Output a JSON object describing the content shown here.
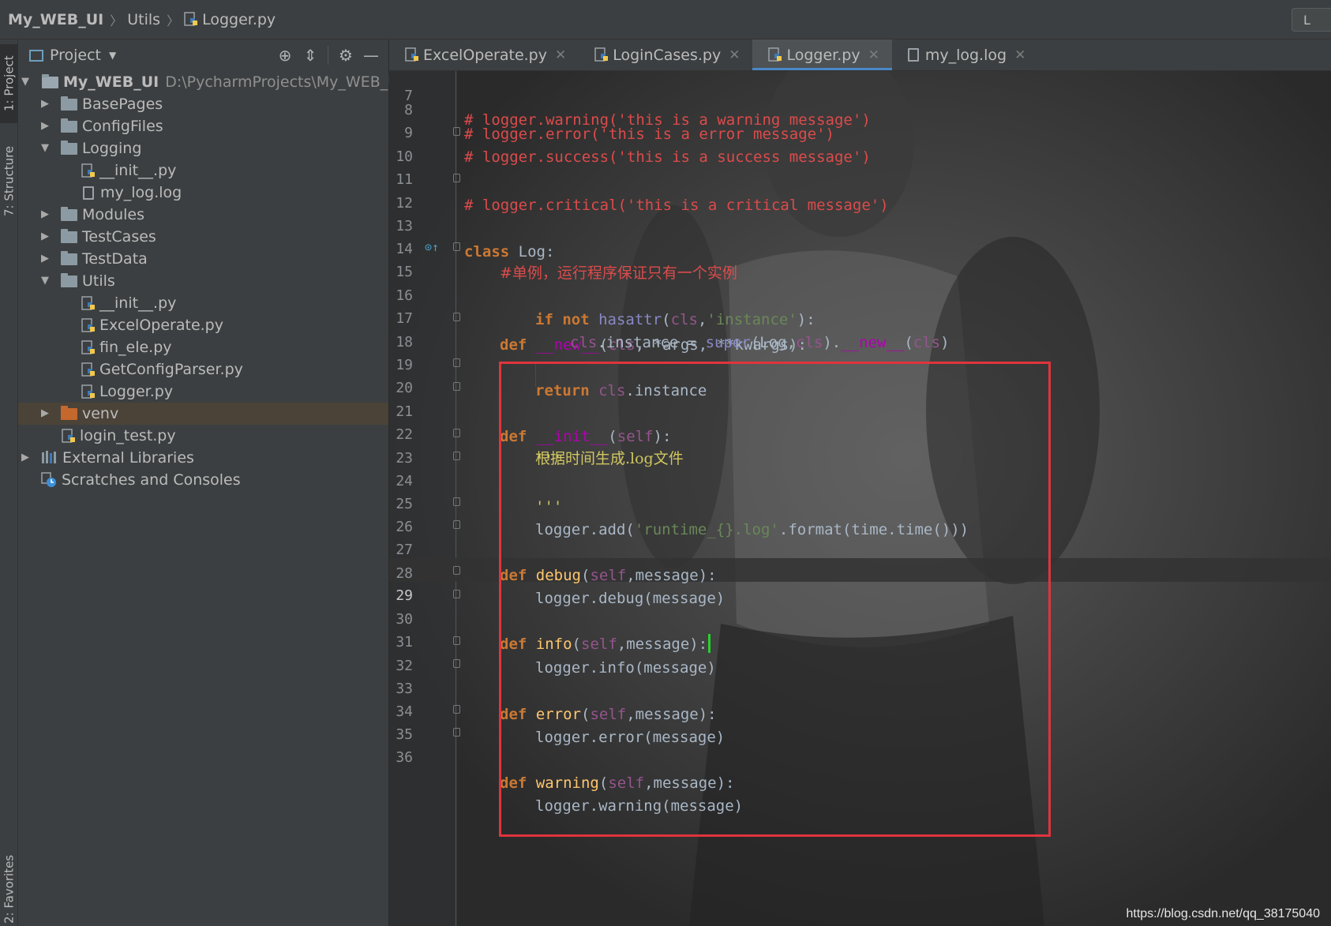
{
  "breadcrumb": {
    "project": "My_WEB_UI",
    "folder": "Utils",
    "file": "Logger.py"
  },
  "navbar_right_label": "L",
  "left_stripe": {
    "project_tab": "1: Project",
    "structure_tab": "7: Structure",
    "favorites_tab": "2: Favorites"
  },
  "project_panel": {
    "title": "Project",
    "tools": [
      "locate-icon",
      "collapse-icon",
      "gear-icon",
      "hide-icon"
    ],
    "tree": [
      {
        "label": "My_WEB_UI",
        "path": "D:\\PycharmProjects\\My_WEB_UI",
        "type": "root",
        "expanded": true
      },
      {
        "label": "BasePages",
        "type": "folder",
        "expanded": false
      },
      {
        "label": "ConfigFiles",
        "type": "folder",
        "expanded": false
      },
      {
        "label": "Logging",
        "type": "folder",
        "expanded": true
      },
      {
        "label": "__init__.py",
        "type": "py"
      },
      {
        "label": "my_log.log",
        "type": "log"
      },
      {
        "label": "Modules",
        "type": "folder",
        "expanded": false
      },
      {
        "label": "TestCases",
        "type": "folder",
        "expanded": false
      },
      {
        "label": "TestData",
        "type": "folder",
        "expanded": false
      },
      {
        "label": "Utils",
        "type": "folder",
        "expanded": true
      },
      {
        "label": "__init__.py",
        "type": "py"
      },
      {
        "label": "ExcelOperate.py",
        "type": "py"
      },
      {
        "label": "fin_ele.py",
        "type": "py"
      },
      {
        "label": "GetConfigParser.py",
        "type": "py"
      },
      {
        "label": "Logger.py",
        "type": "py"
      },
      {
        "label": "venv",
        "type": "folder-orange",
        "expanded": false,
        "selected": true
      },
      {
        "label": "login_test.py",
        "type": "py"
      },
      {
        "label": "External Libraries",
        "type": "lib",
        "expanded": false
      },
      {
        "label": "Scratches and Consoles",
        "type": "scratch"
      }
    ]
  },
  "tabs": [
    {
      "label": "ExcelOperate.py",
      "active": false
    },
    {
      "label": "LoginCases.py",
      "active": false
    },
    {
      "label": "Logger.py",
      "active": true
    },
    {
      "label": "my_log.log",
      "active": false
    }
  ],
  "code": {
    "current_line": 29,
    "lines": {
      "7": "# logger.warning('this is a warning message')",
      "8": "# logger.error('this is a error message')",
      "9": "# logger.success('this is a success message')",
      "10": "# logger.critical('this is a critical message')",
      "12": "class Log:",
      "14": "#单例，运行程序保证只有一个实例",
      "15": "def __new__(cls, *args, **kwargs):",
      "16": "if not hasattr(cls,'instance'):",
      "17": "cls.instance = super(Log,cls).__new__(cls)",
      "18": "return cls.instance",
      "20": "def __init__(self):",
      "21": "'''",
      "22": "根据时间生成.log文件",
      "23": "'''",
      "24": "logger.add('runtime_{}.log'.format(time.time()))",
      "26": "def debug(self,message):",
      "27": "logger.debug(message)",
      "29": "def info(self,message):",
      "30": "logger.info(message)",
      "32": "def error(self,message):",
      "33": "logger.error(message)",
      "35": "def warning(self,message):",
      "36": "logger.warning(message)"
    }
  },
  "watermark": "https://blog.csdn.net/qq_38175040",
  "colors": {
    "keyword": "#cc7832",
    "comment": "#dc4b4b",
    "string": "#6a8759",
    "self": "#94558d",
    "function": "#ffc66d",
    "highlight_box": "#e0343d",
    "active_tab_underline": "#4a88c7",
    "cursor": "#26d12e"
  }
}
